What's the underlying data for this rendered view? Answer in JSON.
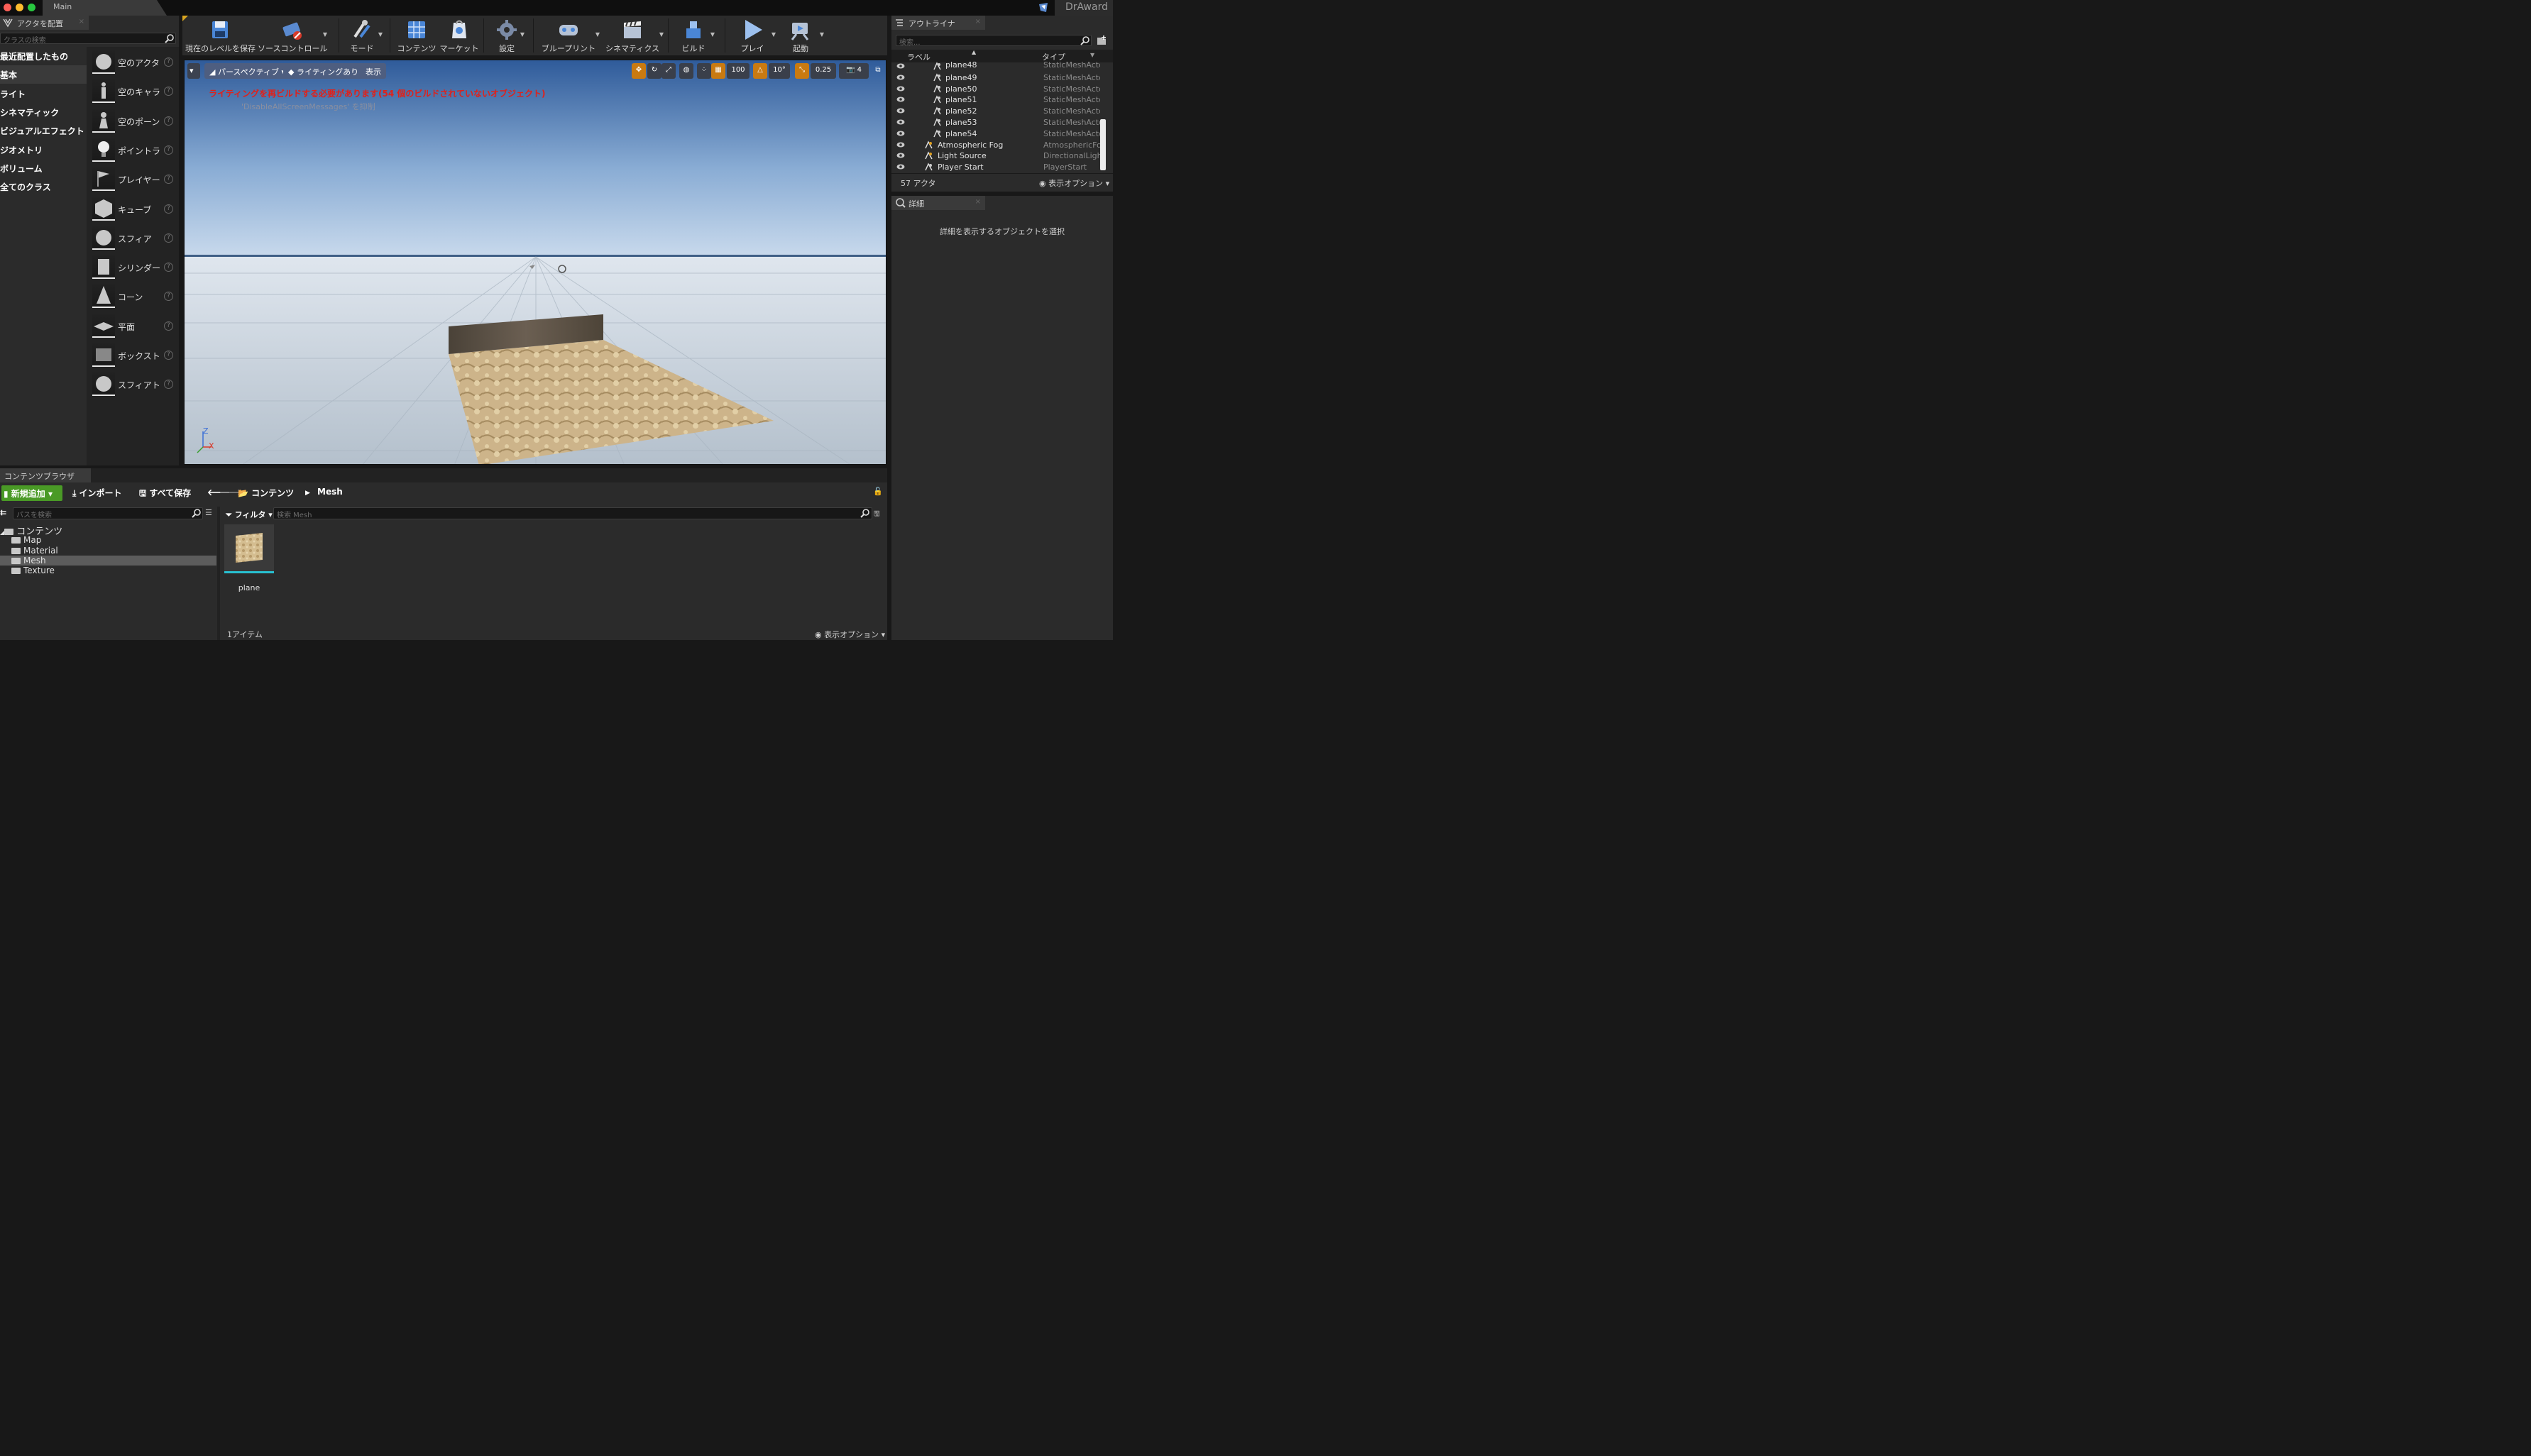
{
  "window": {
    "tab": "Main",
    "app": "DrAward"
  },
  "place_actors": {
    "tab": "アクタを配置",
    "search_placeholder": "クラスの検索",
    "categories": [
      "最近配置したもの",
      "基本",
      "ライト",
      "シネマティック",
      "ビジュアルエフェクト",
      "ジオメトリ",
      "ボリューム",
      "全てのクラス"
    ],
    "items": [
      "空のアクタ",
      "空のキャラクター",
      "空のポーン",
      "ポイントライト",
      "プレイヤースタート",
      "キューブ",
      "スフィア",
      "シリンダー",
      "コーン",
      "平面",
      "ボックストリガー",
      "スフィアトリガー"
    ]
  },
  "toolbar": {
    "buttons": [
      "現在のレベルを保存",
      "ソースコントロール",
      "モード",
      "コンテンツ",
      "マーケット",
      "設定",
      "ブループリント",
      "シネマティクス",
      "ビルド",
      "プレイ",
      "起動"
    ]
  },
  "viewport": {
    "perspective": "パースペクティブ",
    "lighting": "ライティングあり",
    "show": "表示",
    "warning": "ライティングを再ビルドする必要があります(54 個のビルドされていないオブジェクト)",
    "sub_warning": "'DisableAllScreenMessages' を抑制",
    "snap_grid": "100",
    "snap_rot": "10°",
    "snap_scale": "0.25",
    "cam_speed": "4",
    "axis_z": "Z",
    "axis_x": "X"
  },
  "outliner": {
    "tab": "アウトライナ",
    "search_placeholder": "検索...",
    "col_label": "ラベル",
    "col_type": "タイプ",
    "rows": [
      {
        "name": "plane48",
        "type": "StaticMeshActor"
      },
      {
        "name": "plane49",
        "type": "StaticMeshActor"
      },
      {
        "name": "plane50",
        "type": "StaticMeshActor"
      },
      {
        "name": "plane51",
        "type": "StaticMeshActor"
      },
      {
        "name": "plane52",
        "type": "StaticMeshActor"
      },
      {
        "name": "plane53",
        "type": "StaticMeshActor"
      },
      {
        "name": "plane54",
        "type": "StaticMeshActor"
      },
      {
        "name": "Atmospheric Fog",
        "type": "AtmosphericFog"
      },
      {
        "name": "Light Source",
        "type": "DirectionalLight"
      },
      {
        "name": "Player Start",
        "type": "PlayerStart"
      }
    ],
    "count": "57 アクタ",
    "view_options": "表示オプション"
  },
  "details": {
    "tab": "詳細",
    "empty": "詳細を表示するオブジェクトを選択"
  },
  "content_browser": {
    "tab": "コンテンツブラウザ",
    "add_new": "新規追加",
    "import": "インポート",
    "save_all": "すべて保存",
    "path_root": "コンテンツ",
    "path_current": "Mesh",
    "path_search_placeholder": "パスを検索",
    "filter": "フィルタ",
    "asset_search_placeholder": "検索 Mesh",
    "tree": [
      "コンテンツ",
      "Map",
      "Material",
      "Mesh",
      "Texture"
    ],
    "asset_name": "plane",
    "item_count": "1アイテム",
    "view_options": "表示オプション"
  }
}
